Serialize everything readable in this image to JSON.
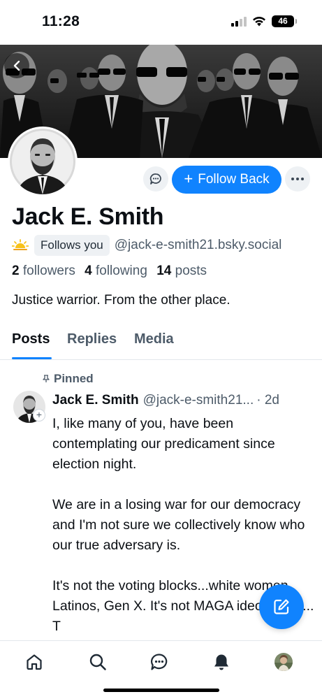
{
  "status_bar": {
    "time": "11:28",
    "battery": "46"
  },
  "profile": {
    "display_name": "Jack E. Smith",
    "follows_you": "Follows you",
    "handle": "@jack-e-smith21.bsky.social",
    "followers_count": "2",
    "followers_label": "followers",
    "following_count": "4",
    "following_label": "following",
    "posts_count": "14",
    "posts_label": "posts",
    "bio": "Justice warrior. From the other place.",
    "follow_back_label": "Follow Back"
  },
  "tabs": [
    {
      "label": "Posts",
      "active": true
    },
    {
      "label": "Replies",
      "active": false
    },
    {
      "label": "Media",
      "active": false
    }
  ],
  "pinned_post": {
    "pinned_label": "Pinned",
    "author": "Jack E. Smith",
    "handle": "@jack-e-smith21...",
    "time": "· 2d",
    "text": "I, like many of you, have been contemplating our predicament since election night.\n\nWe are in a losing war for our democracy and I'm not sure we collectively know who our true adversary is.\n\nIt's not the voting blocks...white women, Latinos, Gen X. It's not MAGA ideologues... T"
  },
  "nav": [
    "home-icon",
    "search-icon",
    "chat-icon",
    "notifications-icon",
    "profile-avatar"
  ],
  "colors": {
    "accent": "#1083fe",
    "muted_text": "#4d5b69",
    "chip_bg": "#eef1f4"
  }
}
